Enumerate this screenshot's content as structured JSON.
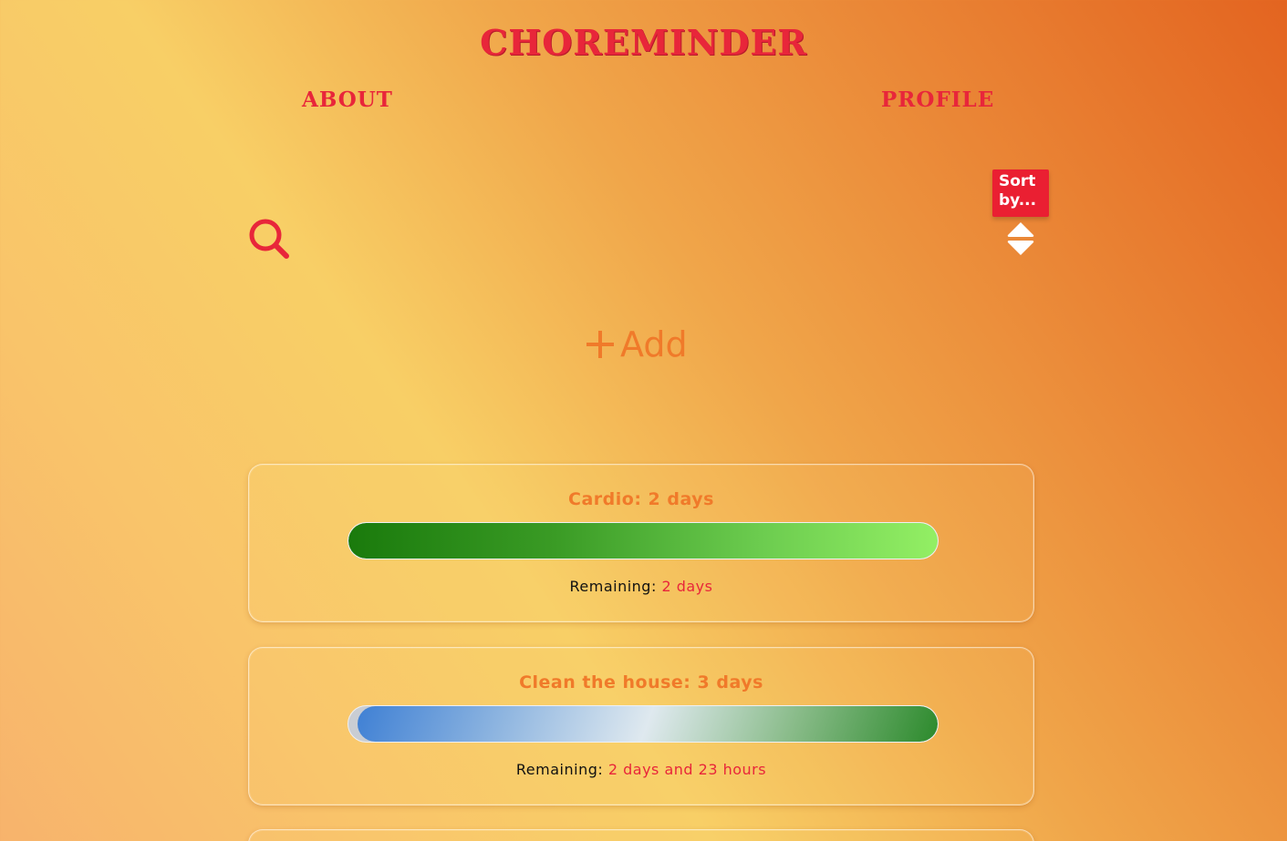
{
  "header": {
    "title": "CHOREMINDER",
    "nav": {
      "about": "ABOUT",
      "profile": "PROFILE"
    }
  },
  "toolbar": {
    "search_icon": "search-icon",
    "sort_label": "Sort by...",
    "sort_icon": "sort-up-down-icon",
    "add_label": "Add",
    "add_icon": "plus-icon"
  },
  "chores": [
    {
      "title": "Cardio: 2 days",
      "remaining_label": "Remaining:",
      "remaining_value": "2 days",
      "progress": 1.0,
      "fill_style": "green"
    },
    {
      "title": "Clean the house: 3 days",
      "remaining_label": "Remaining:",
      "remaining_value": "2 days and 23 hours",
      "progress": 0.985,
      "fill_style": "blue-to-green"
    }
  ],
  "colors": {
    "accent_red": "#e8263a",
    "accent_orange": "#f07a2a",
    "sort_badge": "#ea1f32"
  }
}
